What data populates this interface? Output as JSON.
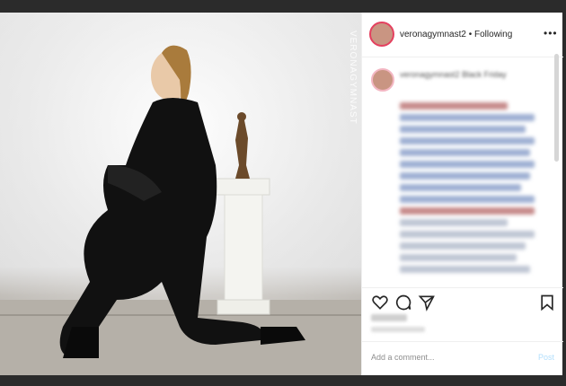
{
  "post": {
    "username": "veronagymnast2",
    "separator": "•",
    "follow_status": "Following",
    "more_label": "•••",
    "caption_username": "veronagymnast2",
    "caption_text": "Black Friday",
    "add_comment_placeholder": "Add a comment...",
    "post_label": "Post"
  },
  "photo": {
    "watermark": "VERONAGYMNAST"
  },
  "icons": {
    "like": "heart-icon",
    "comment": "comment-icon",
    "share": "share-icon",
    "save": "bookmark-icon",
    "more": "more-icon"
  },
  "colors": {
    "avatar_ring": "#e4405f",
    "post_button": "#b2dffc",
    "text": "#262626",
    "muted": "#8e8e8e"
  }
}
